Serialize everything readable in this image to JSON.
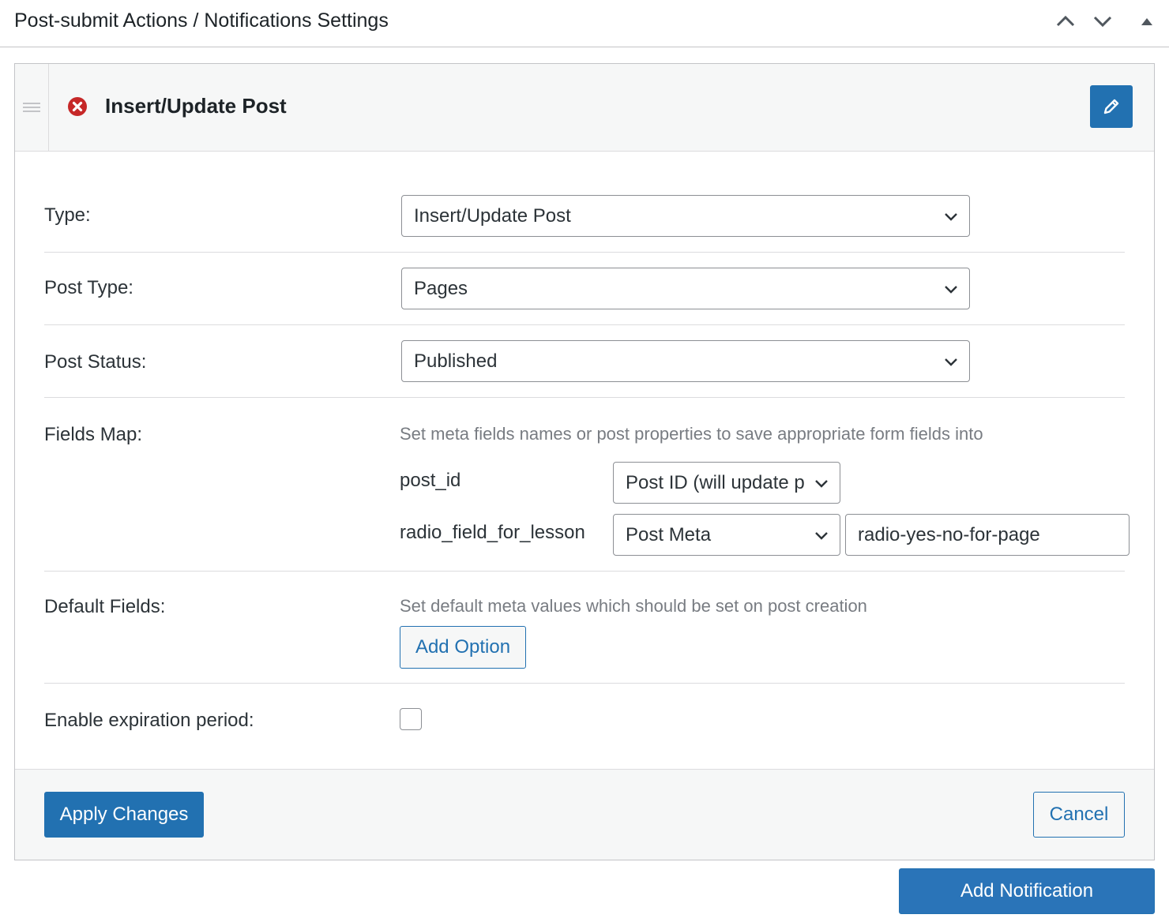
{
  "header": {
    "title": "Post-submit Actions / Notifications Settings",
    "icons": [
      "chevron-up-icon",
      "chevron-down-icon",
      "triangle-up-icon"
    ]
  },
  "notification": {
    "title": "Insert/Update Post",
    "delete_icon": "circle-x-icon",
    "edit_icon": "pencil-icon",
    "fields": {
      "type": {
        "label": "Type:",
        "value": "Insert/Update Post"
      },
      "post_type": {
        "label": "Post Type:",
        "value": "Pages"
      },
      "post_status": {
        "label": "Post Status:",
        "value": "Published"
      },
      "fields_map": {
        "label": "Fields Map:",
        "description": "Set meta fields names or post properties to save appropriate form fields into",
        "rows": [
          {
            "key": "post_id",
            "select": "Post ID (will update post)"
          },
          {
            "key": "radio_field_for_lesson",
            "select": "Post Meta",
            "input": "radio-yes-no-for-page"
          }
        ]
      },
      "default_fields": {
        "label": "Default Fields:",
        "description": "Set default meta values which should be set on post creation",
        "add_option": "Add Option"
      },
      "expiration": {
        "label": "Enable expiration period:",
        "checked": false
      }
    },
    "footer": {
      "apply": "Apply Changes",
      "cancel": "Cancel"
    }
  },
  "add_notification": "Add Notification",
  "colors": {
    "primary": "#2271b1",
    "danger": "#d63638",
    "border": "#c3c4c7",
    "panel_bg": "#f6f7f7"
  }
}
